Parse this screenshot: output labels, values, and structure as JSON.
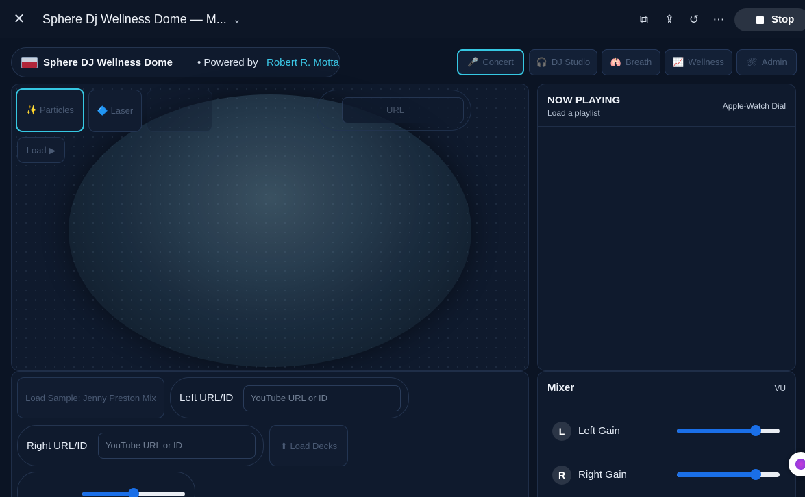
{
  "window": {
    "title": "Sphere Dj Wellness Dome — M...",
    "stop_label": "Stop"
  },
  "brand": {
    "name": "Sphere DJ Wellness Dome",
    "powered_by": "• Powered by",
    "author": "Robert R. Motta"
  },
  "nav": {
    "items": [
      {
        "icon": "🎤",
        "label": "Concert"
      },
      {
        "icon": "🎧",
        "label": "DJ Studio"
      },
      {
        "icon": "🫁",
        "label": "Breath"
      },
      {
        "icon": "📈",
        "label": "Wellness"
      },
      {
        "icon": "🛠",
        "label": "Admin"
      }
    ]
  },
  "visual": {
    "particles": {
      "icon": "✨",
      "label": "Particles"
    },
    "laser": {
      "icon": "🔷",
      "label": "Laser"
    },
    "url_placeholder": "URL",
    "load_label": "Load ▶"
  },
  "now_playing": {
    "title": "NOW PLAYING",
    "subtitle": "Load a playlist",
    "dial": "Apple-Watch Dial"
  },
  "decks": {
    "load_sample": "Load Sample: Jenny Preston Mix",
    "left_label": "Left URL/ID",
    "left_placeholder": "YouTube URL or ID",
    "right_label": "Right URL/ID",
    "right_placeholder": "YouTube URL or ID",
    "load_decks": "Load Decks",
    "load_decks_icon": "⬆",
    "crossfade": 0.5
  },
  "mixer": {
    "title": "Mixer",
    "vu": "VU",
    "left": {
      "badge": "L",
      "label": "Left Gain",
      "value": 0.8
    },
    "right": {
      "badge": "R",
      "label": "Right Gain",
      "value": 0.8
    }
  }
}
